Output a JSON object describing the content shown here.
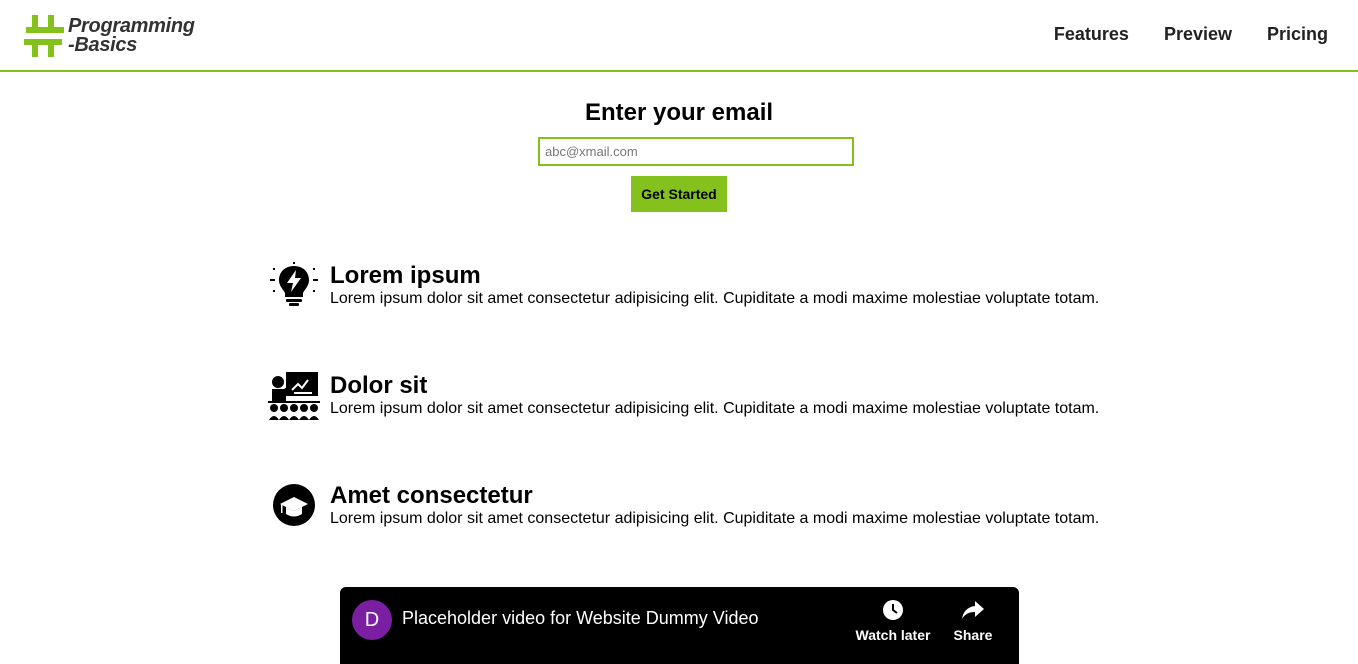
{
  "header": {
    "logo": {
      "line1": "Programming",
      "line2": "-Basics"
    },
    "nav": [
      "Features",
      "Preview",
      "Pricing"
    ]
  },
  "signup": {
    "title": "Enter your email",
    "email_placeholder": "abc@xmail.com",
    "button_label": "Get Started"
  },
  "features": [
    {
      "icon": "lightbulb-icon",
      "title": "Lorem ipsum",
      "text": "Lorem ipsum dolor sit amet consectetur adipisicing elit. Cupiditate a modi maxime molestiae voluptate totam."
    },
    {
      "icon": "classroom-icon",
      "title": "Dolor sit",
      "text": "Lorem ipsum dolor sit amet consectetur adipisicing elit. Cupiditate a modi maxime molestiae voluptate totam."
    },
    {
      "icon": "graduation-cap-icon",
      "title": "Amet consectetur",
      "text": "Lorem ipsum dolor sit amet consectetur adipisicing elit. Cupiditate a modi maxime molestiae voluptate totam."
    }
  ],
  "video": {
    "channel_initial": "D",
    "title": "Placeholder video for Website Dummy Video",
    "watch_later_label": "Watch later",
    "share_label": "Share"
  },
  "colors": {
    "accent": "#85c11d",
    "avatar": "#7b1fa2"
  }
}
